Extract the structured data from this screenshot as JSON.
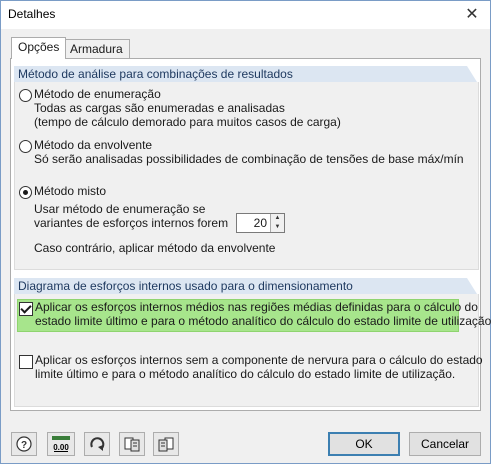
{
  "window": {
    "title": "Detalhes",
    "close_glyph": "✕"
  },
  "tabs": [
    {
      "label": "Opções",
      "active": true
    },
    {
      "label": "Armadura",
      "active": false
    }
  ],
  "group1": {
    "header": "Método de análise para combinações de resultados",
    "options": {
      "enumeration": {
        "label": "Método de enumeração",
        "line1": "Todas as cargas são enumeradas e analisadas",
        "line2": "(tempo de cálculo demorado para muitos casos de carga)",
        "checked": false
      },
      "envelope": {
        "label": "Método da envolvente",
        "line1": "Só serão analisadas possibilidades de combinação de tensões de base máx/mín",
        "checked": false
      },
      "mixed": {
        "label": "Método misto",
        "line1": "Usar método de enumeração se",
        "line2": "variantes de esforços internos forem",
        "value": "20",
        "line3": "Caso contrário, aplicar método da envolvente",
        "checked": true
      }
    }
  },
  "group2": {
    "header": "Diagrama de esforços internos usado para o dimensionamento",
    "check1": {
      "line1": "Aplicar os esforços internos médios nas regiões médias definidas para o cálculo do",
      "line2": "estado limite último e para o método analítico do cálculo do estado limite de utilização.",
      "checked": true
    },
    "check2": {
      "line1": "Aplicar os esforços internos sem a componente de nervura para o cálculo do estado",
      "line2": "limite último e para o método analítico do cálculo do estado limite de utilização.",
      "checked": false
    }
  },
  "footer": {
    "ok": "OK",
    "cancel": "Cancelar",
    "tools": [
      "help-icon",
      "decimals-icon",
      "reset-icon",
      "export-icon",
      "import-icon"
    ],
    "decimals_text": "0.00"
  }
}
